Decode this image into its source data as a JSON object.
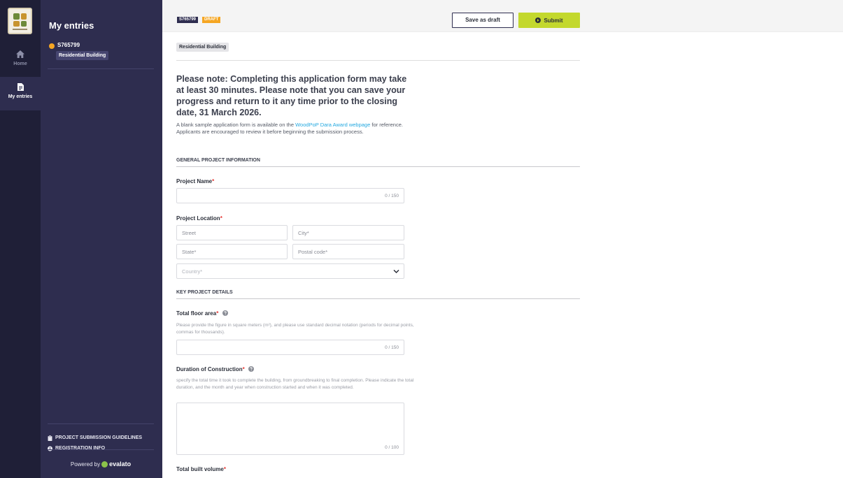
{
  "rail": {
    "home_label": "Home",
    "entries_label": "My entries"
  },
  "panel": {
    "title": "My entries",
    "entry": {
      "id": "S765799",
      "category": "Residential Building",
      "status_color": "#f5a623"
    },
    "links": [
      {
        "label": "PROJECT SUBMISSION GUIDELINES"
      },
      {
        "label": "REGISTRATION INFO"
      }
    ],
    "footer_prefix": "Powered by",
    "footer_brand": "evalato"
  },
  "topbar": {
    "code": "S765799",
    "status": "DRAFT",
    "save_draft_label": "Save as draft",
    "submit_label": "Submit"
  },
  "form": {
    "category_tag": "Residential Building",
    "note_title": "Please note: Completing this application form may take at least 30 minutes. Please note that you can save your progress and return to it any time prior to the closing date, 31 March 2026.",
    "note_text_before": "A blank sample application form is available on the ",
    "note_link": "WoodPoP Dara Award webpage",
    "note_text_after": " for reference. Applicants are encouraged to review it before beginning the submission process.",
    "section_general": "GENERAL PROJECT INFORMATION",
    "project_name": {
      "label": "Project Name",
      "required": "*",
      "counter": "0 / 150"
    },
    "project_location": {
      "label": "Project Location",
      "required": "*",
      "street": "Street",
      "city": "City*",
      "state": "State*",
      "postal": "Postal code*",
      "country": "Country*"
    },
    "section_key": "KEY PROJECT DETAILS",
    "floor_area": {
      "label": "Total floor area",
      "required": "*",
      "hint": "Please provide the figure in square meters (m²), and please use standard decimal notation (periods for decimal points, commas for thousands).",
      "counter": "0 / 150"
    },
    "duration": {
      "label": "Duration of Construction",
      "required": "*",
      "hint": "specify the total time it took to complete the building, from groundbreaking to final completion. Please indicate the total duration, and the month and year when construction started and when it was completed.",
      "counter": "0 / 100"
    },
    "volume": {
      "label": "Total built volume",
      "required": "*"
    }
  },
  "colors": {
    "rail_bg": "#1f1f37",
    "panel_bg": "#2e2d4f",
    "draft_badge": "#f5a623",
    "submit_bg": "#c3d82d",
    "link": "#25a9e0",
    "required": "#e53935"
  },
  "icons": [
    "logo",
    "home-icon",
    "document-icon",
    "clipboard-icon",
    "info-icon",
    "evalato-logo-icon",
    "submit-circle-icon",
    "help-icon",
    "chevron-down-icon"
  ]
}
